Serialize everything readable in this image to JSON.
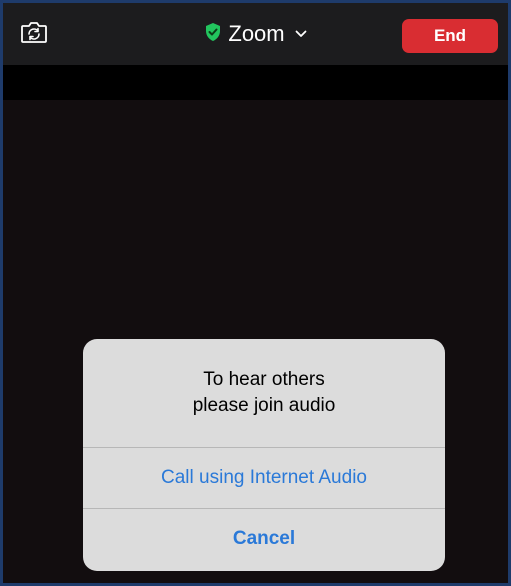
{
  "header": {
    "title": "Zoom",
    "end_label": "End",
    "icons": {
      "camera_switch": "camera-switch-icon",
      "shield": "shield-check-icon",
      "chevron": "chevron-down-icon"
    },
    "colors": {
      "end": "#d92d32",
      "shield": "#22c55e"
    }
  },
  "dialog": {
    "message_line1": "To hear others",
    "message_line2": "please join audio",
    "primary_action": "Call using Internet Audio",
    "cancel_label": "Cancel",
    "action_color": "#2a79d8"
  }
}
